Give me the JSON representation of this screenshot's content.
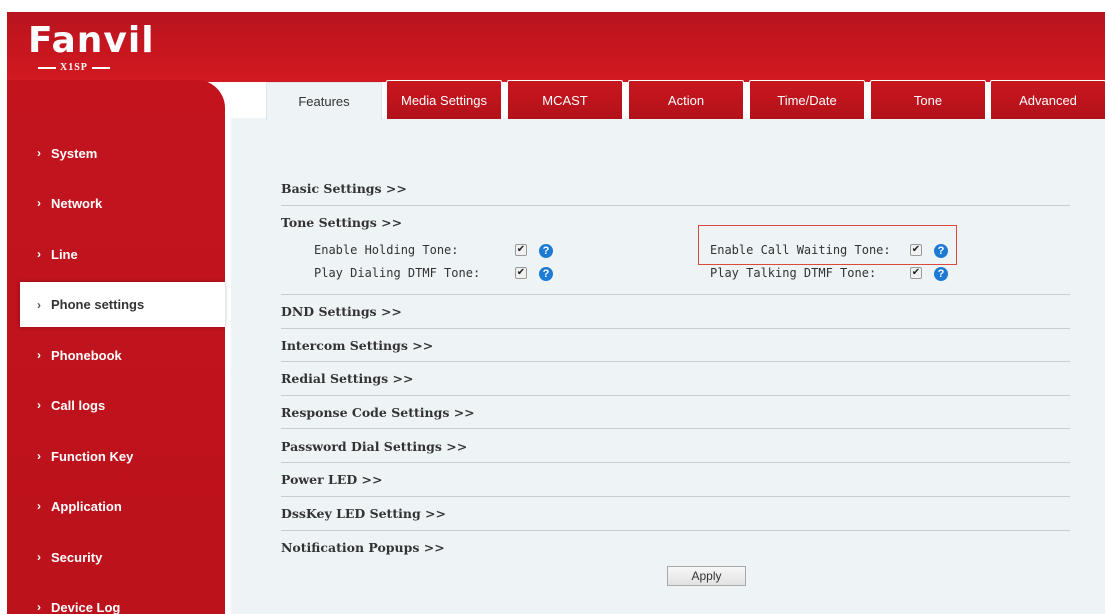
{
  "header": {
    "brand": "Fanvil",
    "model": "X1SP"
  },
  "sidebar": {
    "items": [
      {
        "label": "System"
      },
      {
        "label": "Network"
      },
      {
        "label": "Line"
      },
      {
        "label": "Phone settings",
        "active": true
      },
      {
        "label": "Phonebook"
      },
      {
        "label": "Call logs"
      },
      {
        "label": "Function Key"
      },
      {
        "label": "Application"
      },
      {
        "label": "Security"
      },
      {
        "label": "Device Log"
      }
    ],
    "chevron": "›"
  },
  "tabs": [
    {
      "label": "Features",
      "active": true
    },
    {
      "label": "Media Settings"
    },
    {
      "label": "MCAST"
    },
    {
      "label": "Action"
    },
    {
      "label": "Time/Date"
    },
    {
      "label": "Tone"
    },
    {
      "label": "Advanced"
    }
  ],
  "sections": {
    "basic": "Basic Settings >>",
    "tone": "Tone Settings >>",
    "dnd": "DND Settings >>",
    "intercom": "Intercom Settings >>",
    "redial": "Redial Settings >>",
    "response_code": "Response Code Settings >>",
    "password_dial": "Password Dial Settings >>",
    "power_led": "Power LED >>",
    "dsskey_led": "DssKey LED Setting >>",
    "notification": "Notification Popups >>"
  },
  "tone_settings": {
    "enable_holding_tone": {
      "label": "Enable Holding Tone:",
      "checked": true
    },
    "play_dialing_dtmf_tone": {
      "label": "Play Dialing DTMF Tone:",
      "checked": true
    },
    "enable_call_waiting_tone": {
      "label": "Enable Call Waiting Tone:",
      "checked": true
    },
    "play_talking_dtmf_tone": {
      "label": "Play Talking DTMF Tone:",
      "checked": true
    }
  },
  "apply_label": "Apply",
  "check_glyph": "✔",
  "help_glyph": "?",
  "colors": {
    "brand_red": "#c3141e",
    "content_bg": "#eef3f6",
    "help_blue": "#1e7bd4",
    "highlight_border": "#d94a3c"
  },
  "icons": {
    "nav": "chevron-right-icon",
    "help": "help-icon",
    "checkbox": "checkbox-checked-icon"
  }
}
